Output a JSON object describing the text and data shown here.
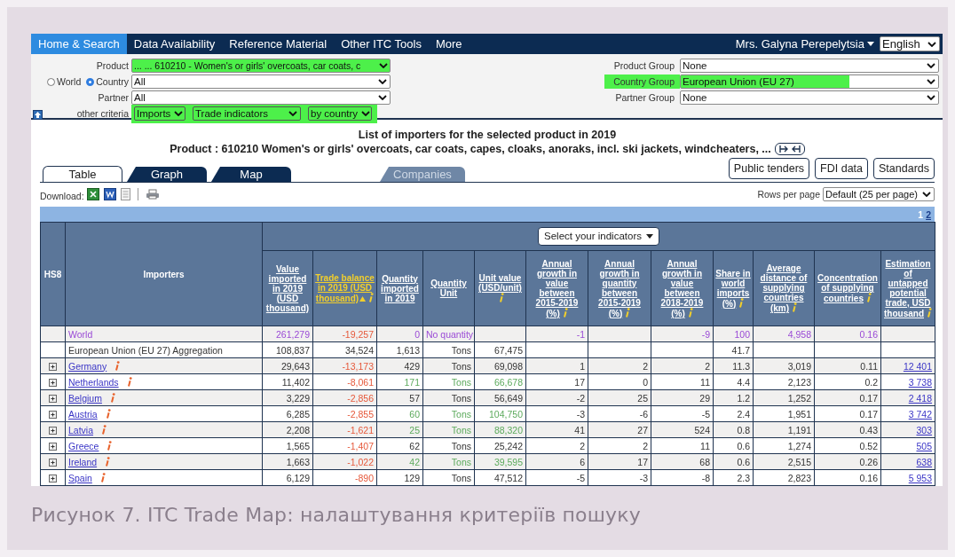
{
  "nav": {
    "items": [
      {
        "label": "Home & Search",
        "selected": true
      },
      {
        "label": "Data Availability",
        "selected": false
      },
      {
        "label": "Reference Material",
        "selected": false
      },
      {
        "label": "Other ITC Tools",
        "selected": false
      },
      {
        "label": "More",
        "selected": false
      }
    ],
    "user": "Mrs. Galyna Perepelytsia",
    "language": "English"
  },
  "criteria": {
    "product": {
      "label": "Product",
      "value": "... ... 610210 - Women's or girls' overcoats, car coats, c",
      "highlighted": true
    },
    "scope": {
      "options": [
        {
          "label": "World",
          "selected": false
        },
        {
          "label": "Country",
          "selected": true
        }
      ],
      "value": "All"
    },
    "partner": {
      "label": "Partner",
      "value": "All"
    },
    "other": {
      "label": "other criteria",
      "highlighted": true,
      "selects": [
        "Imports",
        "Trade indicators",
        "by country"
      ]
    },
    "groups": [
      {
        "label": "Product Group",
        "value": "None",
        "highlighted": false
      },
      {
        "label": "Country Group",
        "value": "European Union (EU 27)",
        "highlighted": true
      },
      {
        "label": "Partner Group",
        "value": "None",
        "highlighted": false
      }
    ]
  },
  "heading": "List of importers for the selected product in 2019",
  "product_line": "Product : 610210 Women's or girls' overcoats, car coats, capes, cloaks, anoraks, incl. ski jackets, windcheaters, ...",
  "tabs": [
    {
      "label": "Table",
      "selected": true,
      "disabled": false
    },
    {
      "label": "Graph",
      "selected": false,
      "disabled": false
    },
    {
      "label": "Map",
      "selected": false,
      "disabled": false
    },
    {
      "label": "Companies",
      "selected": false,
      "disabled": true
    }
  ],
  "buttons": [
    "Public tenders",
    "FDI data",
    "Standards"
  ],
  "download_label": "Download:",
  "rows_per_page": {
    "label": "Rows per page",
    "value": "Default (25 per page)"
  },
  "pages": [
    {
      "label": "1",
      "selected": true
    },
    {
      "label": "2",
      "selected": false
    }
  ],
  "table": {
    "indicator_button": "Select your indicators",
    "fixed_columns": [
      "HS8",
      "Importers"
    ],
    "columns": [
      {
        "label": "Value imported in 2019 (USD thousand)",
        "info": false,
        "sorted": false
      },
      {
        "label": "Trade balance in 2019 (USD thousand)",
        "info": true,
        "sorted": true
      },
      {
        "label": "Quantity imported in 2019",
        "info": false,
        "sorted": false
      },
      {
        "label": "Quantity Unit",
        "info": false,
        "sorted": false
      },
      {
        "label": "Unit value (USD/unit)",
        "info": true,
        "sorted": false
      },
      {
        "label": "Annual growth in value between 2015-2019 (%)",
        "info": true,
        "sorted": false
      },
      {
        "label": "Annual growth in quantity between 2015-2019 (%)",
        "info": true,
        "sorted": false
      },
      {
        "label": "Annual growth in value between 2018-2019 (%)",
        "info": true,
        "sorted": false
      },
      {
        "label": "Share in world imports (%)",
        "info": true,
        "sorted": false
      },
      {
        "label": "Average distance of supplying countries (km)",
        "info": true,
        "sorted": false
      },
      {
        "label": "Concentration of supplying countries",
        "info": true,
        "sorted": false
      },
      {
        "label": "Estimation of untapped potential trade, USD thousand",
        "info": true,
        "sorted": false
      }
    ],
    "rows": [
      {
        "kind": "world",
        "name": "World",
        "balance_deficit": true,
        "quantity_highlight": false,
        "values": {
          "0": "261,279",
          "1": "-19,257",
          "2": "0",
          "3": "No quantity",
          "5": "-1",
          "7": "-9",
          "8": "100",
          "9": "4,958",
          "10": "0.16"
        }
      },
      {
        "kind": "aggregate",
        "name": "European Union (EU 27) Aggregation",
        "balance_deficit": false,
        "quantity_highlight": false,
        "values": {
          "0": "108,837",
          "1": "34,524",
          "2": "1,613",
          "3": "Tons",
          "4": "67,475",
          "8": "41.7"
        }
      },
      {
        "kind": "country",
        "name": "Germany",
        "balance_deficit": true,
        "quantity_highlight": false,
        "values": [
          "29,643",
          "-13,173",
          "429",
          "Tons",
          "69,098",
          "1",
          "2",
          "2",
          "11.3",
          "3,019",
          "0.11",
          "12 401"
        ]
      },
      {
        "kind": "country",
        "name": "Netherlands",
        "balance_deficit": true,
        "quantity_highlight": true,
        "values": [
          "11,402",
          "-8,061",
          "171",
          "Tons",
          "66,678",
          "17",
          "0",
          "11",
          "4.4",
          "2,123",
          "0.2",
          "3 738"
        ]
      },
      {
        "kind": "country",
        "name": "Belgium",
        "balance_deficit": true,
        "quantity_highlight": false,
        "values": [
          "3,229",
          "-2,856",
          "57",
          "Tons",
          "56,649",
          "-2",
          "25",
          "29",
          "1.2",
          "1,252",
          "0.17",
          "2 418"
        ]
      },
      {
        "kind": "country",
        "name": "Austria",
        "balance_deficit": true,
        "quantity_highlight": true,
        "values": [
          "6,285",
          "-2,855",
          "60",
          "Tons",
          "104,750",
          "-3",
          "-6",
          "-5",
          "2.4",
          "1,951",
          "0.17",
          "3 742"
        ]
      },
      {
        "kind": "country",
        "name": "Latvia",
        "balance_deficit": true,
        "quantity_highlight": true,
        "values": [
          "2,208",
          "-1,621",
          "25",
          "Tons",
          "88,320",
          "41",
          "27",
          "524",
          "0.8",
          "1,191",
          "0.43",
          "303"
        ]
      },
      {
        "kind": "country",
        "name": "Greece",
        "balance_deficit": true,
        "quantity_highlight": false,
        "values": [
          "1,565",
          "-1,407",
          "62",
          "Tons",
          "25,242",
          "2",
          "2",
          "11",
          "0.6",
          "1,274",
          "0.52",
          "505"
        ]
      },
      {
        "kind": "country",
        "name": "Ireland",
        "balance_deficit": true,
        "quantity_highlight": true,
        "values": [
          "1,663",
          "-1,022",
          "42",
          "Tons",
          "39,595",
          "6",
          "17",
          "68",
          "0.6",
          "2,515",
          "0.26",
          "638"
        ]
      },
      {
        "kind": "country",
        "name": "Spain",
        "balance_deficit": true,
        "quantity_highlight": false,
        "values": [
          "6,129",
          "-890",
          "129",
          "Tons",
          "47,512",
          "-5",
          "-3",
          "-8",
          "2.3",
          "2,823",
          "0.16",
          "5 953"
        ]
      }
    ]
  },
  "caption": "Рисунок 7. ITC Trade Map: налаштування критеріїв пошуку"
}
